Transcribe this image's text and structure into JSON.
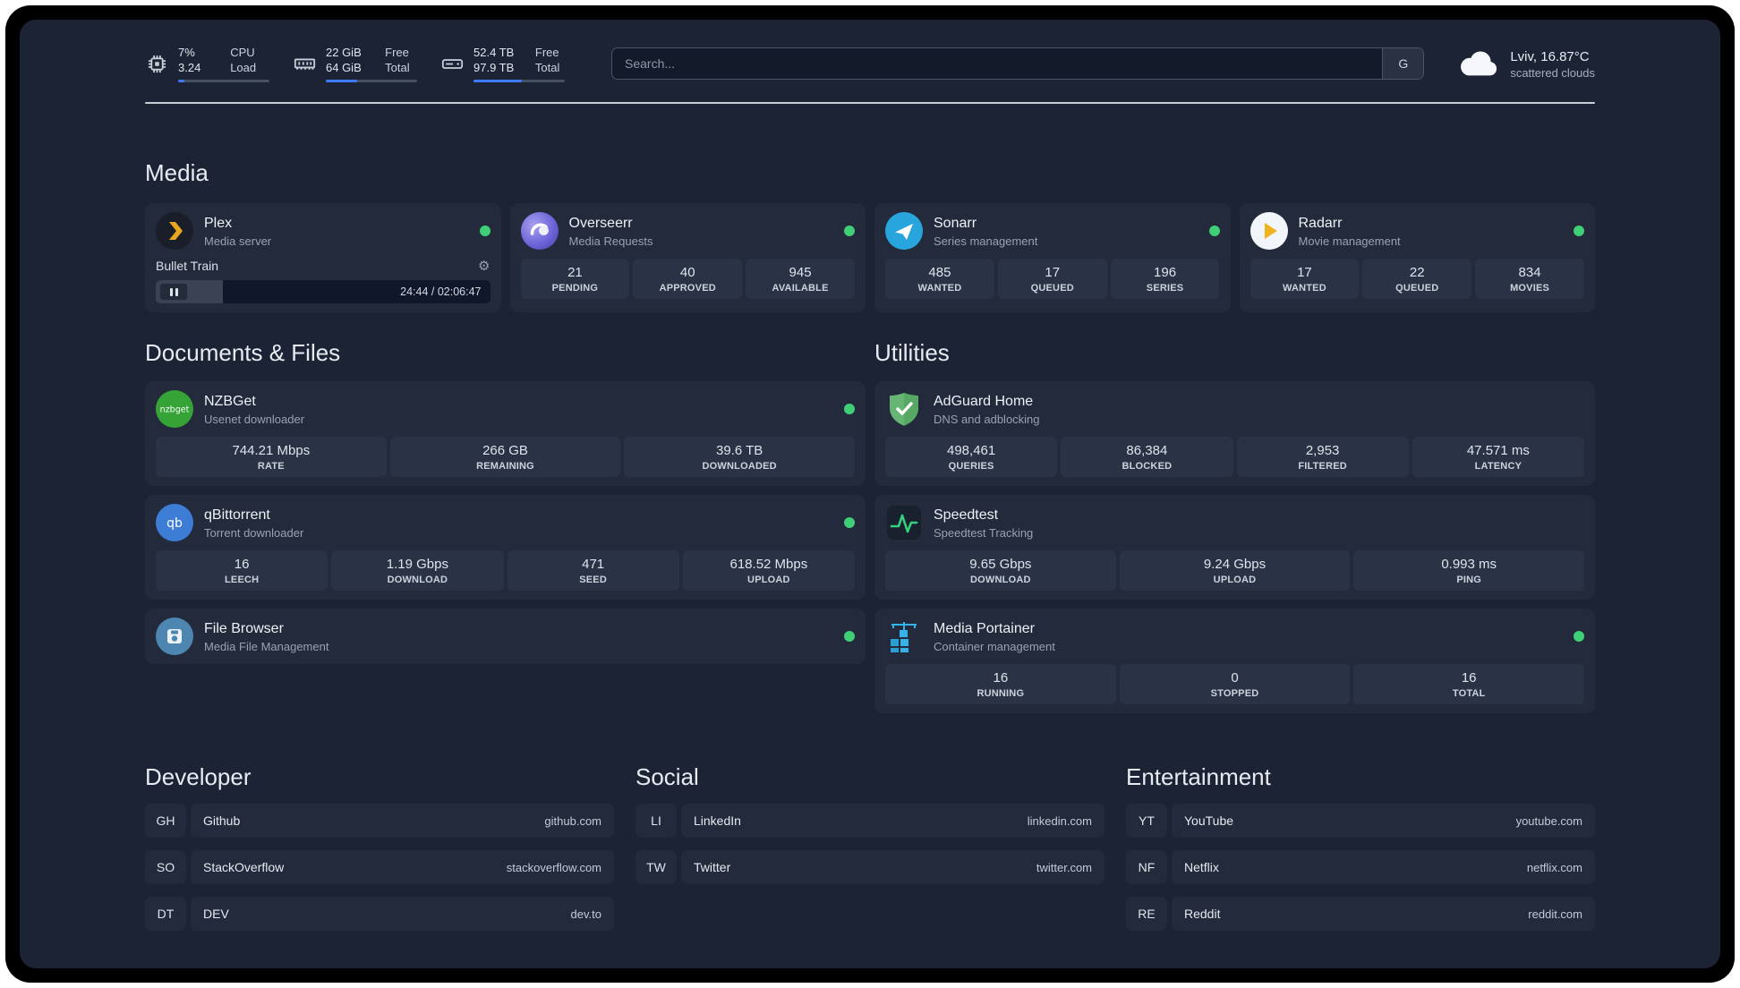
{
  "header": {
    "cpu": {
      "icon": "cpu-icon",
      "value_top": "7%",
      "value_bottom": "3.24",
      "label_top": "CPU",
      "label_bottom": "Load",
      "progress_pct": 7
    },
    "ram": {
      "icon": "ram-icon",
      "value_top": "22 GiB",
      "value_bottom": "64 GiB",
      "label_top": "Free",
      "label_bottom": "Total",
      "progress_pct": 34
    },
    "disk": {
      "icon": "disk-icon",
      "value_top": "52.4 TB",
      "value_bottom": "97.9 TB",
      "label_top": "Free",
      "label_bottom": "Total",
      "progress_pct": 53
    },
    "search": {
      "placeholder": "Search...",
      "button": "G"
    },
    "weather": {
      "icon": "cloud-icon",
      "summary": "Lviv, 16.87°C",
      "condition": "scattered clouds"
    }
  },
  "media": {
    "title": "Media",
    "plex": {
      "name": "Plex",
      "subtitle": "Media server",
      "status": "online",
      "now_playing": "Bullet Train",
      "time": "24:44 / 02:06:47",
      "progress_pct": 20
    },
    "overseerr": {
      "name": "Overseerr",
      "subtitle": "Media Requests",
      "status": "online",
      "stats": [
        {
          "value": "21",
          "label": "PENDING"
        },
        {
          "value": "40",
          "label": "APPROVED"
        },
        {
          "value": "945",
          "label": "AVAILABLE"
        }
      ]
    },
    "sonarr": {
      "name": "Sonarr",
      "subtitle": "Series management",
      "status": "online",
      "stats": [
        {
          "value": "485",
          "label": "WANTED"
        },
        {
          "value": "17",
          "label": "QUEUED"
        },
        {
          "value": "196",
          "label": "SERIES"
        }
      ]
    },
    "radarr": {
      "name": "Radarr",
      "subtitle": "Movie management",
      "status": "online",
      "stats": [
        {
          "value": "17",
          "label": "WANTED"
        },
        {
          "value": "22",
          "label": "QUEUED"
        },
        {
          "value": "834",
          "label": "MOVIES"
        }
      ]
    }
  },
  "documents": {
    "title": "Documents & Files",
    "nzbget": {
      "name": "NZBGet",
      "subtitle": "Usenet downloader",
      "icon_text": "nzbget",
      "status": "online",
      "stats": [
        {
          "value": "744.21 Mbps",
          "label": "RATE"
        },
        {
          "value": "266 GB",
          "label": "REMAINING"
        },
        {
          "value": "39.6 TB",
          "label": "DOWNLOADED"
        }
      ]
    },
    "qbittorrent": {
      "name": "qBittorrent",
      "subtitle": "Torrent downloader",
      "icon_text": "qb",
      "status": "online",
      "stats": [
        {
          "value": "16",
          "label": "LEECH"
        },
        {
          "value": "1.19 Gbps",
          "label": "DOWNLOAD"
        },
        {
          "value": "471",
          "label": "SEED"
        },
        {
          "value": "618.52 Mbps",
          "label": "UPLOAD"
        }
      ]
    },
    "filebrowser": {
      "name": "File Browser",
      "subtitle": "Media File Management",
      "status": "online"
    }
  },
  "utilities": {
    "title": "Utilities",
    "adguard": {
      "name": "AdGuard Home",
      "subtitle": "DNS and adblocking",
      "stats": [
        {
          "value": "498,461",
          "label": "QUERIES"
        },
        {
          "value": "86,384",
          "label": "BLOCKED"
        },
        {
          "value": "2,953",
          "label": "FILTERED"
        },
        {
          "value": "47.571 ms",
          "label": "LATENCY"
        }
      ]
    },
    "speedtest": {
      "name": "Speedtest",
      "subtitle": "Speedtest Tracking",
      "stats": [
        {
          "value": "9.65 Gbps",
          "label": "DOWNLOAD"
        },
        {
          "value": "9.24 Gbps",
          "label": "UPLOAD"
        },
        {
          "value": "0.993 ms",
          "label": "PING"
        }
      ]
    },
    "portainer": {
      "name": "Media Portainer",
      "subtitle": "Container management",
      "status": "online",
      "stats": [
        {
          "value": "16",
          "label": "RUNNING"
        },
        {
          "value": "0",
          "label": "STOPPED"
        },
        {
          "value": "16",
          "label": "TOTAL"
        }
      ]
    }
  },
  "links": {
    "developer": {
      "title": "Developer",
      "items": [
        {
          "badge": "GH",
          "name": "Github",
          "url": "github.com"
        },
        {
          "badge": "SO",
          "name": "StackOverflow",
          "url": "stackoverflow.com"
        },
        {
          "badge": "DT",
          "name": "DEV",
          "url": "dev.to"
        }
      ]
    },
    "social": {
      "title": "Social",
      "items": [
        {
          "badge": "LI",
          "name": "LinkedIn",
          "url": "linkedin.com"
        },
        {
          "badge": "TW",
          "name": "Twitter",
          "url": "twitter.com"
        }
      ]
    },
    "entertainment": {
      "title": "Entertainment",
      "items": [
        {
          "badge": "YT",
          "name": "YouTube",
          "url": "youtube.com"
        },
        {
          "badge": "NF",
          "name": "Netflix",
          "url": "netflix.com"
        },
        {
          "badge": "RE",
          "name": "Reddit",
          "url": "reddit.com"
        }
      ]
    }
  },
  "colors": {
    "status_online": "#3fcf77",
    "progress_fill": "#3e7bfa",
    "plex_amber": "#e9a51e",
    "background": "#1b2334",
    "card": "#222a3b",
    "stat_tile": "#2a3345"
  }
}
